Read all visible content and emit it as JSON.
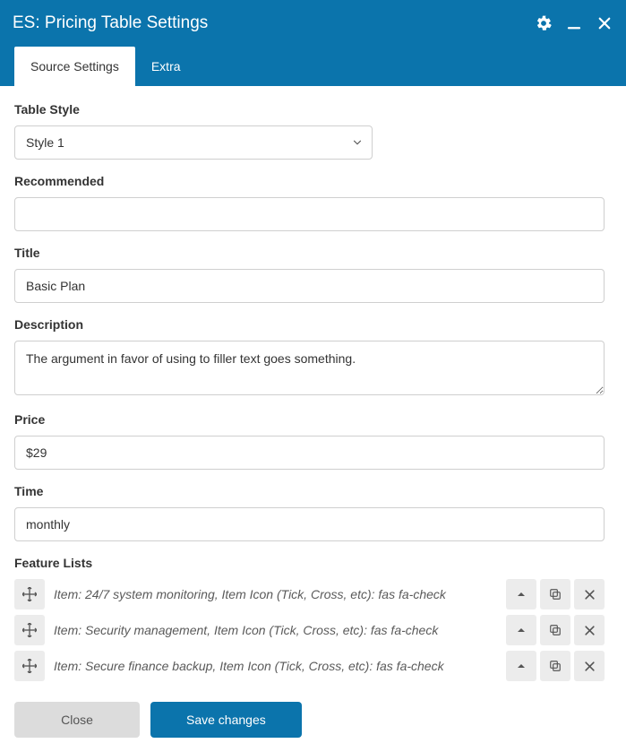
{
  "window": {
    "title": "ES: Pricing Table Settings"
  },
  "tabs": {
    "source": "Source Settings",
    "extra": "Extra"
  },
  "fields": {
    "table_style": {
      "label": "Table Style",
      "value": "Style 1"
    },
    "recommended": {
      "label": "Recommended",
      "value": ""
    },
    "title": {
      "label": "Title",
      "value": "Basic Plan"
    },
    "description": {
      "label": "Description",
      "value": "The argument in favor of using to filler text goes something."
    },
    "price": {
      "label": "Price",
      "value": "$29"
    },
    "time": {
      "label": "Time",
      "value": "monthly"
    },
    "feature_lists": {
      "label": "Feature Lists"
    }
  },
  "features": [
    {
      "text": "Item: 24/7 system monitoring, Item Icon (Tick, Cross, etc): fas fa-check"
    },
    {
      "text": "Item: Security management, Item Icon (Tick, Cross, etc): fas fa-check"
    },
    {
      "text": "Item: Secure finance backup, Item Icon (Tick, Cross, etc): fas fa-check"
    }
  ],
  "footer": {
    "close": "Close",
    "save": "Save changes"
  }
}
